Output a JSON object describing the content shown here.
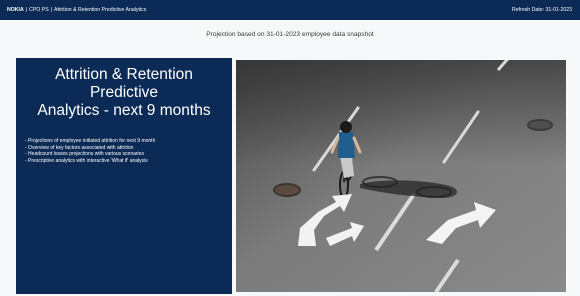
{
  "header": {
    "brand": "NOKIA",
    "breadcrumb": [
      "CPO PS",
      "Attrition & Retention Predictive Analytics"
    ],
    "refresh_label": "Refresh Date: 31-01-2023"
  },
  "subtitle": "Projection based on 31-01-2023 employee data snapshot",
  "panel": {
    "title_line1": "Attrition & Retention Predictive",
    "title_line2": "Analytics - next 9 months",
    "bullets": [
      "- Projections of employee initiated attrition for next 9 month",
      "- Overview of key factors associated with attrition",
      "- Headcount losses projections with various scenarios",
      "- Prescriptive analytics with interactive 'What if' analysis"
    ]
  },
  "colors": {
    "header_bg": "#0b2a55",
    "panel_bg": "#0b2a55",
    "page_bg": "#f7f8fa"
  }
}
